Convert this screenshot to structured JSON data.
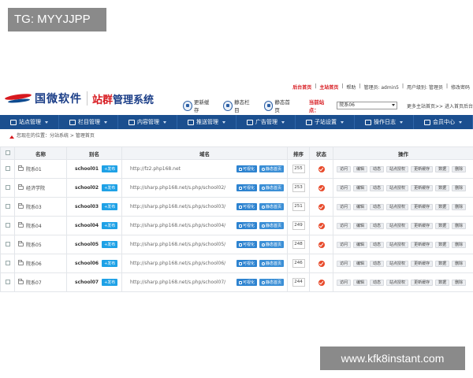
{
  "overlay": {
    "tg": "TG: MYYJJPP",
    "url": "www.kfk8instant.com"
  },
  "header": {
    "logo_cn": "国微软件",
    "sys_red": "站群",
    "sys_rest": "管理系统",
    "top_links": [
      "后台首页",
      "主站首页",
      "帮助",
      "管理员: admin5",
      "用户级别: 管理员",
      "修改密码"
    ],
    "quick": [
      {
        "label": "更新缓存",
        "icon": "refresh-icon"
      },
      {
        "label": "静态栏目",
        "icon": "columns-icon"
      },
      {
        "label": "静态首页",
        "icon": "home-page-icon"
      }
    ],
    "site_label": "当前站点：",
    "site_value": "院系06",
    "extra": "更多主站首页>>  进入首页后台"
  },
  "nav": [
    {
      "label": "站点管理",
      "icon": "site-icon"
    },
    {
      "label": "栏目管理",
      "icon": "column-icon"
    },
    {
      "label": "内容管理",
      "icon": "content-icon"
    },
    {
      "label": "推送管理",
      "icon": "push-icon"
    },
    {
      "label": "广告管理",
      "icon": "ad-icon"
    },
    {
      "label": "子站设置",
      "icon": "subsite-icon"
    },
    {
      "label": "操作日志",
      "icon": "log-icon"
    },
    {
      "label": "会员中心",
      "icon": "member-icon"
    }
  ],
  "breadcrumb": "您现在的位置：分站系统 > 管理首页",
  "table": {
    "headers": [
      "名称",
      "别名",
      "域名",
      "排序",
      "状态",
      "操作"
    ],
    "publish_label": "+发布",
    "btn_static": "可视化",
    "btn_home": "静态首页",
    "ops": [
      "访问",
      "编辑",
      "动态",
      "站点授权",
      "更新缓存",
      "数据",
      "删除"
    ],
    "rows": [
      {
        "name": "院系01",
        "alias": "school01",
        "domain": "http://fz2.php168.net",
        "sort": "255"
      },
      {
        "name": "经济学院",
        "alias": "school02",
        "domain": "http://sharp.php168.net/s.php/school02/",
        "sort": "253"
      },
      {
        "name": "院系03",
        "alias": "school03",
        "domain": "http://sharp.php168.net/s.php/school03/",
        "sort": "251"
      },
      {
        "name": "院系04",
        "alias": "school04",
        "domain": "http://sharp.php168.net/s.php/school04/",
        "sort": "249"
      },
      {
        "name": "院系05",
        "alias": "school05",
        "domain": "http://sharp.php168.net/s.php/school05/",
        "sort": "248"
      },
      {
        "name": "院系06",
        "alias": "school06",
        "domain": "http://sharp.php168.net/s.php/school06/",
        "sort": "246"
      },
      {
        "name": "院系07",
        "alias": "school07",
        "domain": "http://sharp.php168.net/s.php/school07/",
        "sort": "244"
      }
    ]
  }
}
